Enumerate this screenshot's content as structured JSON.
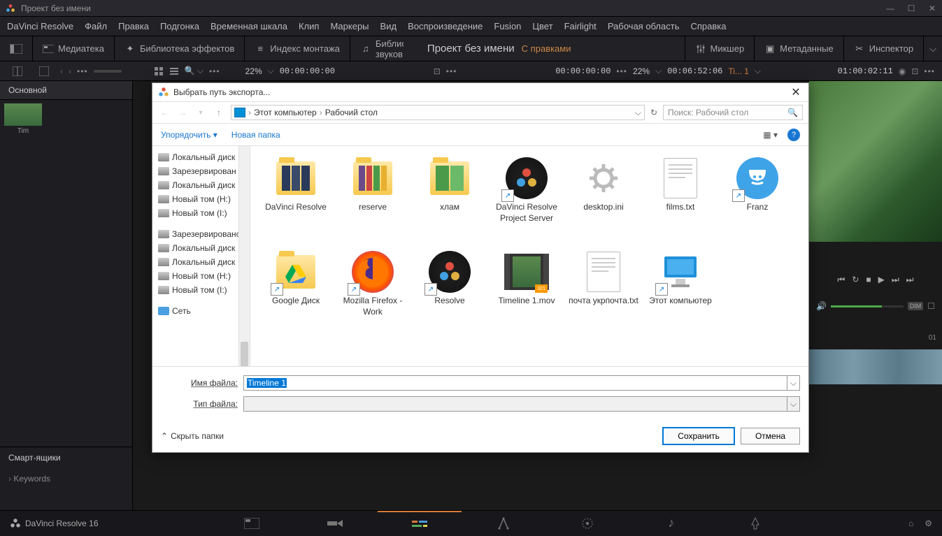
{
  "titlebar": {
    "title": "Проект без имени"
  },
  "menubar": [
    "DaVinci Resolve",
    "Файл",
    "Правка",
    "Подгонка",
    "Временная шкала",
    "Клип",
    "Маркеры",
    "Вид",
    "Воспроизведение",
    "Fusion",
    "Цвет",
    "Fairlight",
    "Рабочая область",
    "Справка"
  ],
  "toolbar": {
    "media": "Медиатека",
    "effects": "Библиотека эффектов",
    "index": "Индекс монтажа",
    "library": "Библиотека звуков",
    "project": "Проект без имени",
    "edited": "С правками",
    "mixer": "Микшер",
    "metadata": "Метаданные",
    "inspector": "Инспектор"
  },
  "timeline": {
    "pct_left": "22%",
    "tc1": "00:00:00:00",
    "tc2": "00:00:00:00",
    "pct_right": "22%",
    "tc3": "00:06:52:06",
    "ti": "Ti... 1",
    "tc4": "01:00:02:11",
    "ts01": "01"
  },
  "leftpanel": {
    "tab": "Основной",
    "thumb_label": "Tim",
    "smart": "Смарт-ящики",
    "keywords": "Keywords"
  },
  "dialog": {
    "title": "Выбрать путь экспорта...",
    "bc1": "Этот компьютер",
    "bc2": "Рабочий стол",
    "search_placeholder": "Поиск: Рабочий стол",
    "cmd_organize": "Упорядочить",
    "cmd_newfolder": "Новая папка",
    "tree": [
      "Локальный диск",
      "Зарезервирован",
      "Локальный диск",
      "Новый том (H:)",
      "Новый том (I:)",
      "",
      "Зарезервировано",
      "Локальный диск",
      "Локальный диск",
      "Новый том (H:)",
      "Новый том (I:)",
      "",
      "Сеть"
    ],
    "files": [
      {
        "name": "DaVinci Resolve",
        "type": "folder-dr"
      },
      {
        "name": "reserve",
        "type": "folder-color"
      },
      {
        "name": "хлам",
        "type": "folder-green"
      },
      {
        "name": "DaVinci Resolve Project Server",
        "type": "resolve",
        "shortcut": true
      },
      {
        "name": "desktop.ini",
        "type": "gear"
      },
      {
        "name": "films.txt",
        "type": "txt"
      },
      {
        "name": "Franz",
        "type": "franz",
        "shortcut": true
      },
      {
        "name": "Google Диск",
        "type": "gdrive",
        "shortcut": true
      },
      {
        "name": "Mozilla Firefox - Work",
        "type": "firefox",
        "shortcut": true
      },
      {
        "name": "Resolve",
        "type": "resolve2",
        "shortcut": true
      },
      {
        "name": "Timeline 1.mov",
        "type": "video"
      },
      {
        "name": "почта укрпочта.txt",
        "type": "txt"
      },
      {
        "name": "Этот компьютер",
        "type": "monitor",
        "shortcut": true
      }
    ],
    "label_filename": "Имя файла:",
    "label_filetype": "Тип файла:",
    "filename_value": "Timeline 1",
    "filetype_value": "",
    "hide_folders": "Скрыть папки",
    "btn_save": "Сохранить",
    "btn_cancel": "Отмена"
  },
  "bottom": {
    "app": "DaVinci Resolve 16",
    "dim": "DIM"
  }
}
